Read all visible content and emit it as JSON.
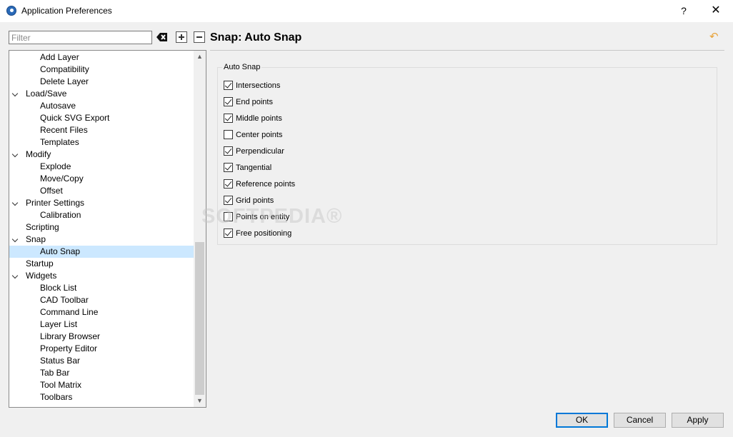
{
  "window": {
    "title": "Application Preferences",
    "help_label": "?",
    "close_label": "✕"
  },
  "filter": {
    "placeholder": "Filter",
    "value": ""
  },
  "toolbar": {
    "clear_icon": "clear-filter-icon",
    "expand_icon": "expand-all-icon",
    "collapse_icon": "collapse-all-icon"
  },
  "tree": {
    "rows": [
      {
        "label": "Add Layer",
        "level": 1
      },
      {
        "label": "Compatibility",
        "level": 1
      },
      {
        "label": "Delete Layer",
        "level": 1
      },
      {
        "label": "Load/Save",
        "level": 0,
        "expanded": true
      },
      {
        "label": "Autosave",
        "level": 1
      },
      {
        "label": "Quick SVG Export",
        "level": 1
      },
      {
        "label": "Recent Files",
        "level": 1
      },
      {
        "label": "Templates",
        "level": 1
      },
      {
        "label": "Modify",
        "level": 0,
        "expanded": true
      },
      {
        "label": "Explode",
        "level": 1
      },
      {
        "label": "Move/Copy",
        "level": 1
      },
      {
        "label": "Offset",
        "level": 1
      },
      {
        "label": "Printer Settings",
        "level": 0,
        "expanded": true
      },
      {
        "label": "Calibration",
        "level": 1
      },
      {
        "label": "Scripting",
        "level": 0
      },
      {
        "label": "Snap",
        "level": 0,
        "expanded": true
      },
      {
        "label": "Auto Snap",
        "level": 1,
        "selected": true
      },
      {
        "label": "Startup",
        "level": 0
      },
      {
        "label": "Widgets",
        "level": 0,
        "expanded": true
      },
      {
        "label": "Block List",
        "level": 1
      },
      {
        "label": "CAD Toolbar",
        "level": 1
      },
      {
        "label": "Command Line",
        "level": 1
      },
      {
        "label": "Layer List",
        "level": 1
      },
      {
        "label": "Library Browser",
        "level": 1
      },
      {
        "label": "Property Editor",
        "level": 1
      },
      {
        "label": "Status Bar",
        "level": 1
      },
      {
        "label": "Tab Bar",
        "level": 1
      },
      {
        "label": "Tool Matrix",
        "level": 1
      },
      {
        "label": "Toolbars",
        "level": 1
      }
    ],
    "scroll_up": "▲",
    "scroll_down": "▼"
  },
  "page": {
    "title": "Snap: Auto Snap",
    "reset_icon": "reset-icon"
  },
  "group": {
    "title": "Auto Snap",
    "options": [
      {
        "label": "Intersections",
        "checked": true
      },
      {
        "label": "End points",
        "checked": true
      },
      {
        "label": "Middle points",
        "checked": true
      },
      {
        "label": "Center points",
        "checked": false
      },
      {
        "label": "Perpendicular",
        "checked": true
      },
      {
        "label": "Tangential",
        "checked": true
      },
      {
        "label": "Reference points",
        "checked": true
      },
      {
        "label": "Grid points",
        "checked": true
      },
      {
        "label": "Points on entity",
        "checked": false
      },
      {
        "label": "Free positioning",
        "checked": true
      }
    ]
  },
  "watermark": "SOFTPEDIA®",
  "buttons": {
    "ok": "OK",
    "cancel": "Cancel",
    "apply": "Apply"
  },
  "colors": {
    "selection": "#cce8ff",
    "default_button_border": "#0078d7",
    "reset_icon": "#e8a33a"
  }
}
